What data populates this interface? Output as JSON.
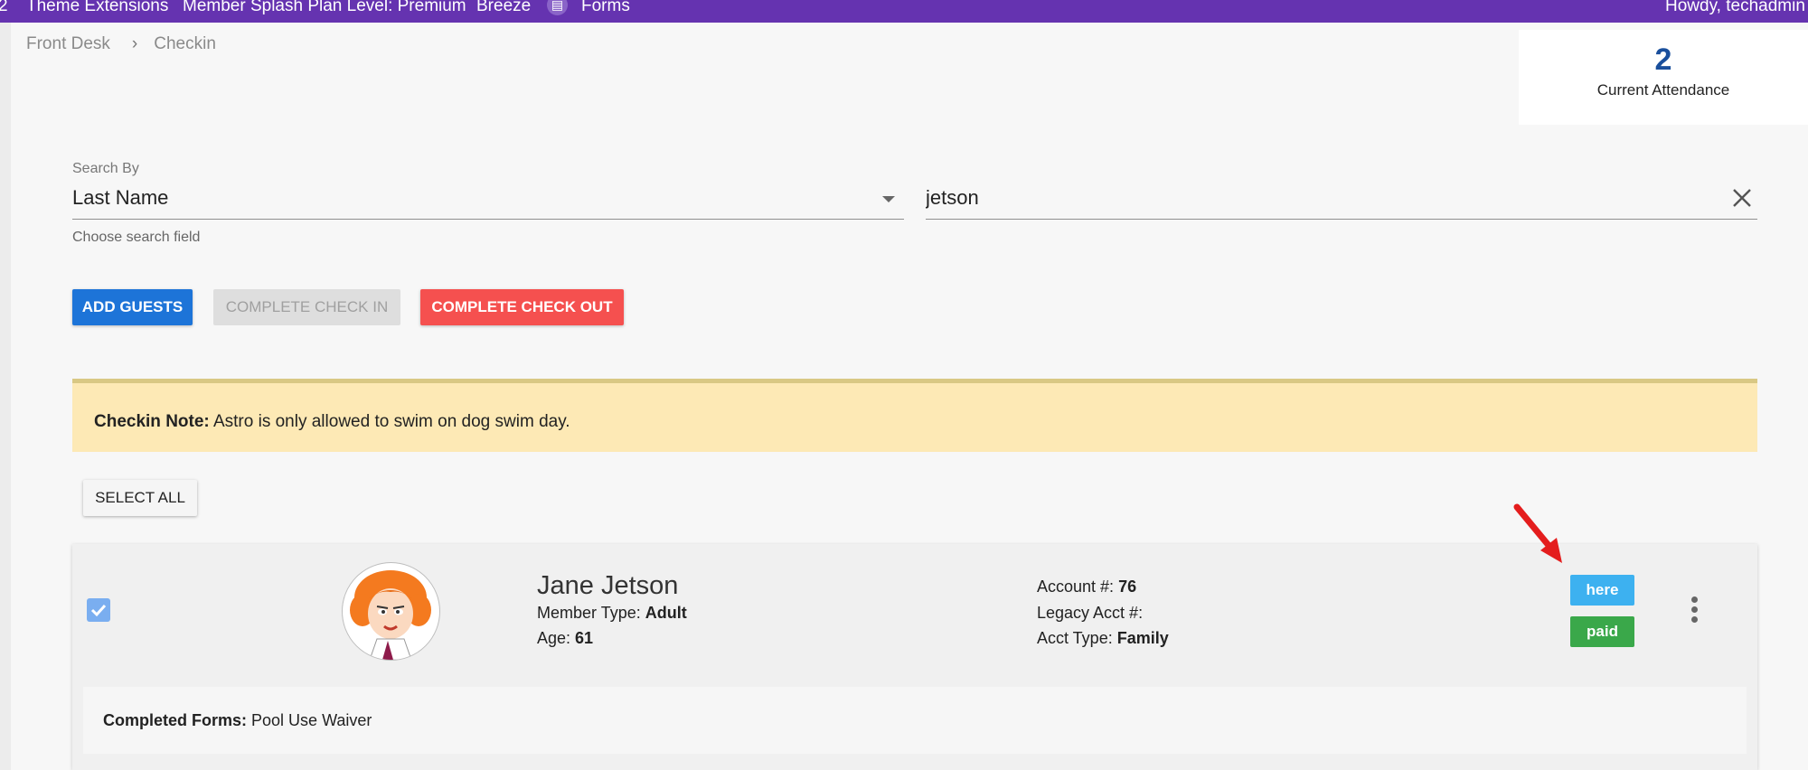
{
  "topbar": {
    "items": [
      "Theme Extensions",
      "Member Splash Plan Level: Premium",
      "Breeze",
      "Forms"
    ],
    "greeting": "Howdy, techadmin",
    "left_fragment": "2"
  },
  "breadcrumb": {
    "parent": "Front Desk",
    "separator": "›",
    "current": "Checkin"
  },
  "attendance": {
    "count": "2",
    "label": "Current Attendance"
  },
  "search": {
    "by_label": "Search By",
    "by_value": "Last Name",
    "helper": "Choose search field",
    "query": "jetson"
  },
  "buttons": {
    "add_guests": "ADD GUESTS",
    "complete_check_in": "COMPLETE CHECK IN",
    "complete_check_out": "COMPLETE CHECK OUT",
    "select_all": "SELECT ALL"
  },
  "note": {
    "label": "Checkin Note:",
    "text": "Astro is only allowed to swim on dog swim day."
  },
  "member": {
    "name": "Jane Jetson",
    "member_type_label": "Member Type:",
    "member_type": "Adult",
    "age_label": "Age:",
    "age": "61",
    "account_label": "Account #:",
    "account": "76",
    "legacy_label": "Legacy Acct #:",
    "legacy": "",
    "acct_type_label": "Acct Type:",
    "acct_type": "Family",
    "status_here": "here",
    "status_paid": "paid",
    "forms_label": "Completed Forms:",
    "forms": "Pool Use Waiver"
  },
  "colors": {
    "topbar": "#6533b0",
    "primary": "#1d74d8",
    "danger": "#f5504f",
    "note_bg": "#fde9b5",
    "here_badge": "#3db1f0",
    "paid_badge": "#3aa84a",
    "attendance_number": "#1a4f9c"
  },
  "icons": [
    "forms-icon",
    "chevron-right-icon",
    "dropdown-caret-icon",
    "close-icon",
    "checkbox-checked-icon",
    "more-vert-icon",
    "red-arrow-annotation"
  ]
}
